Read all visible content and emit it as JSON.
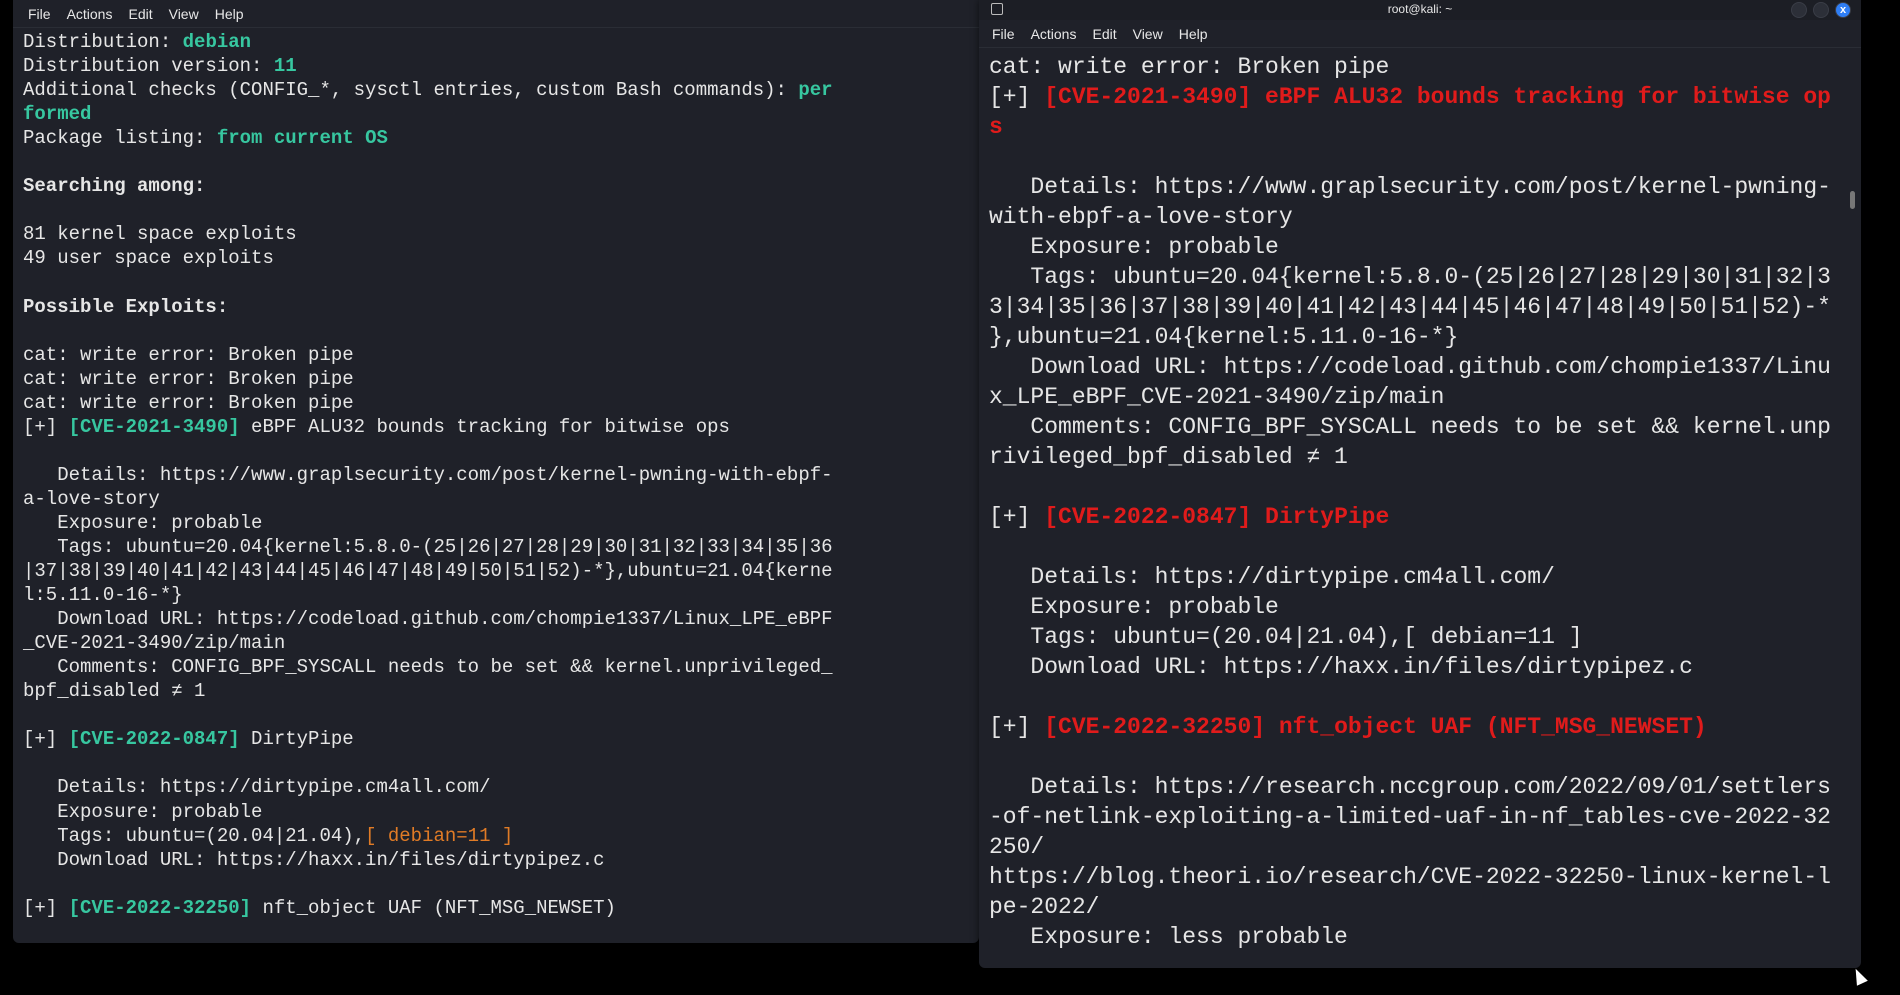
{
  "left_window": {
    "menu": [
      "File",
      "Actions",
      "Edit",
      "View",
      "Help"
    ],
    "lines": [
      [
        [
          "Distribution: ",
          ""
        ],
        [
          "debian",
          "g"
        ]
      ],
      [
        [
          "Distribution version: ",
          ""
        ],
        [
          "11",
          "g"
        ]
      ],
      [
        [
          "Additional checks (CONFIG_*, sysctl entries, custom Bash commands): ",
          ""
        ],
        [
          "per",
          "g"
        ]
      ],
      [
        [
          "formed",
          "g"
        ]
      ],
      [
        [
          "Package listing: ",
          ""
        ],
        [
          "from current OS",
          "g"
        ]
      ],
      [],
      [
        [
          "Searching among:",
          "b"
        ]
      ],
      [],
      [
        [
          "81 kernel space exploits",
          ""
        ]
      ],
      [
        [
          "49 user space exploits",
          ""
        ]
      ],
      [],
      [
        [
          "Possible Exploits:",
          "b"
        ]
      ],
      [],
      [
        [
          "cat: write error: Broken pipe",
          ""
        ]
      ],
      [
        [
          "cat: write error: Broken pipe",
          ""
        ]
      ],
      [
        [
          "cat: write error: Broken pipe",
          ""
        ]
      ],
      [
        [
          "[+] ",
          ""
        ],
        [
          "[CVE-2021-3490]",
          "g"
        ],
        [
          " eBPF ALU32 bounds tracking for bitwise ops",
          ""
        ]
      ],
      [],
      [
        [
          "   Details: https://www.graplsecurity.com/post/kernel-pwning-with-ebpf-",
          ""
        ]
      ],
      [
        [
          "a-love-story",
          ""
        ]
      ],
      [
        [
          "   Exposure: probable",
          ""
        ]
      ],
      [
        [
          "   Tags: ubuntu=20.04{kernel:5.8.0-(25|26|27|28|29|30|31|32|33|34|35|36",
          ""
        ]
      ],
      [
        [
          "|37|38|39|40|41|42|43|44|45|46|47|48|49|50|51|52)-*},ubuntu=21.04{kerne",
          ""
        ]
      ],
      [
        [
          "l:5.11.0-16-*}",
          ""
        ]
      ],
      [
        [
          "   Download URL: https://codeload.github.com/chompie1337/Linux_LPE_eBPF",
          ""
        ]
      ],
      [
        [
          "_CVE-2021-3490/zip/main",
          ""
        ]
      ],
      [
        [
          "   Comments: CONFIG_BPF_SYSCALL needs to be set && kernel.unprivileged_",
          ""
        ]
      ],
      [
        [
          "bpf_disabled ≠ 1",
          ""
        ]
      ],
      [],
      [
        [
          "[+] ",
          ""
        ],
        [
          "[CVE-2022-0847]",
          "g"
        ],
        [
          " DirtyPipe",
          ""
        ]
      ],
      [],
      [
        [
          "   Details: https://dirtypipe.cm4all.com/",
          ""
        ]
      ],
      [
        [
          "   Exposure: probable",
          ""
        ]
      ],
      [
        [
          "   Tags: ubuntu=(20.04|21.04),",
          ""
        ],
        [
          "[ debian=11 ]",
          "o"
        ]
      ],
      [
        [
          "   Download URL: https://haxx.in/files/dirtypipez.c",
          ""
        ]
      ],
      [],
      [
        [
          "[+] ",
          ""
        ],
        [
          "[CVE-2022-32250]",
          "g"
        ],
        [
          " nft_object UAF (NFT_MSG_NEWSET)",
          ""
        ]
      ]
    ]
  },
  "right_window": {
    "title": "root@kali: ~",
    "close_label": "x",
    "menu": [
      "File",
      "Actions",
      "Edit",
      "View",
      "Help"
    ],
    "lines": [
      [
        [
          "cat: write error: Broken pipe",
          ""
        ]
      ],
      [
        [
          "[+] ",
          ""
        ],
        [
          "[CVE-2021-3490] eBPF ALU32 bounds tracking for bitwise op",
          "r"
        ]
      ],
      [
        [
          "s",
          "r"
        ]
      ],
      [],
      [
        [
          "   Details: https://www.graplsecurity.com/post/kernel-pwning-",
          ""
        ]
      ],
      [
        [
          "with-ebpf-a-love-story",
          ""
        ]
      ],
      [
        [
          "   Exposure: probable",
          ""
        ]
      ],
      [
        [
          "   Tags: ubuntu=20.04{kernel:5.8.0-(25|26|27|28|29|30|31|32|3",
          ""
        ]
      ],
      [
        [
          "3|34|35|36|37|38|39|40|41|42|43|44|45|46|47|48|49|50|51|52)-*",
          ""
        ]
      ],
      [
        [
          "},ubuntu=21.04{kernel:5.11.0-16-*}",
          ""
        ]
      ],
      [
        [
          "   Download URL: https://codeload.github.com/chompie1337/Linu",
          ""
        ]
      ],
      [
        [
          "x_LPE_eBPF_CVE-2021-3490/zip/main",
          ""
        ]
      ],
      [
        [
          "   Comments: CONFIG_BPF_SYSCALL needs to be set && kernel.unp",
          ""
        ]
      ],
      [
        [
          "rivileged_bpf_disabled ≠ 1",
          ""
        ]
      ],
      [],
      [
        [
          "[+] ",
          ""
        ],
        [
          "[CVE-2022-0847] DirtyPipe",
          "r"
        ]
      ],
      [],
      [
        [
          "   Details: https://dirtypipe.cm4all.com/",
          ""
        ]
      ],
      [
        [
          "   Exposure: probable",
          ""
        ]
      ],
      [
        [
          "   Tags: ubuntu=(20.04|21.04),[ debian=11 ]",
          ""
        ]
      ],
      [
        [
          "   Download URL: https://haxx.in/files/dirtypipez.c",
          ""
        ]
      ],
      [],
      [
        [
          "[+] ",
          ""
        ],
        [
          "[CVE-2022-32250] nft_object UAF (NFT_MSG_NEWSET)",
          "r"
        ]
      ],
      [],
      [
        [
          "   Details: https://research.nccgroup.com/2022/09/01/settlers",
          ""
        ]
      ],
      [
        [
          "-of-netlink-exploiting-a-limited-uaf-in-nf_tables-cve-2022-32",
          ""
        ]
      ],
      [
        [
          "250/",
          ""
        ]
      ],
      [
        [
          "https://blog.theori.io/research/CVE-2022-32250-linux-kernel-l",
          ""
        ]
      ],
      [
        [
          "pe-2022/",
          ""
        ]
      ],
      [
        [
          "   Exposure: less probable",
          ""
        ]
      ]
    ]
  },
  "colors": {
    "background": "#1f2129",
    "highlight": "#37c7a0",
    "red": "#e01b1b",
    "orange": "#e07b26"
  }
}
